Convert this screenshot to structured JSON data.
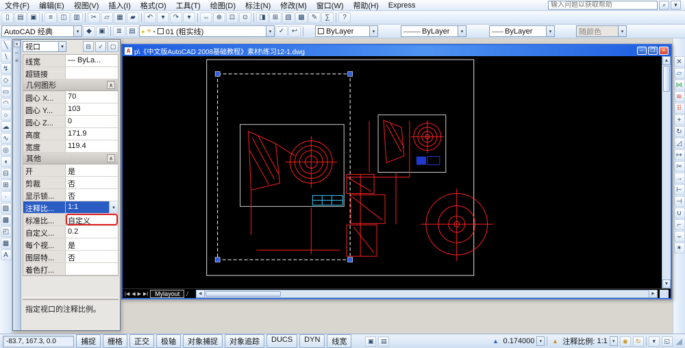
{
  "colors": {
    "cad_red": "#ff2020",
    "cad_cyan": "#39c7ff",
    "cad_blue_fill": "#2238c8",
    "grip_blue": "#2e5ce0",
    "selection_highlight": "#2a5cc4",
    "annotation_marker_red": "#e02121",
    "titlebar_blue": "#1c5be0",
    "canvas_black": "#000000"
  },
  "menu": {
    "items": [
      "文件(F)",
      "编辑(E)",
      "视图(V)",
      "插入(I)",
      "格式(O)",
      "工具(T)",
      "绘图(D)",
      "标注(N)",
      "修改(M)",
      "窗口(W)",
      "帮助(H)",
      "Express"
    ],
    "help_placeholder": "输入问题以获取帮助"
  },
  "toolbar_standard": {
    "icons": [
      {
        "name": "new-icon",
        "glyph": "▯"
      },
      {
        "name": "open-icon",
        "glyph": "▤"
      },
      {
        "name": "save-icon",
        "glyph": "▣"
      },
      {
        "sep": true
      },
      {
        "name": "plot-icon",
        "glyph": "≡"
      },
      {
        "name": "plot-preview-icon",
        "glyph": "◫"
      },
      {
        "name": "publish-icon",
        "glyph": "▥"
      },
      {
        "sep": true
      },
      {
        "name": "cut-icon",
        "glyph": "✂"
      },
      {
        "name": "copy-icon",
        "glyph": "▱"
      },
      {
        "name": "paste-icon",
        "glyph": "▦"
      },
      {
        "name": "match-properties-icon",
        "glyph": "▰"
      },
      {
        "sep": true
      },
      {
        "name": "undo-icon",
        "glyph": "↶"
      },
      {
        "name": "undo-list-icon",
        "glyph": "▾"
      },
      {
        "name": "redo-icon",
        "glyph": "↷"
      },
      {
        "name": "redo-list-icon",
        "glyph": "▾"
      },
      {
        "sep": true
      },
      {
        "name": "pan-icon",
        "glyph": "⇔"
      },
      {
        "name": "zoom-realtime-icon",
        "glyph": "⊕"
      },
      {
        "name": "zoom-window-icon",
        "glyph": "⊡"
      },
      {
        "name": "zoom-previous-icon",
        "glyph": "⊙"
      },
      {
        "sep": true
      },
      {
        "name": "properties-icon",
        "glyph": "◨"
      },
      {
        "name": "designcenter-icon",
        "glyph": "⊞"
      },
      {
        "name": "tool-palettes-icon",
        "glyph": "▧"
      },
      {
        "name": "sheet-set-manager-icon",
        "glyph": "▩"
      },
      {
        "name": "markup-set-manager-icon",
        "glyph": "✎"
      },
      {
        "name": "quickcalc-icon",
        "glyph": "∑"
      },
      {
        "sep": true
      },
      {
        "name": "help-icon",
        "glyph": "?"
      }
    ]
  },
  "toolbar_object": {
    "workspace": "AutoCAD 经典",
    "layer": "01 (粗实线)",
    "color": "ByLayer",
    "linetype": "ByLayer",
    "lineweight": "ByLayer",
    "plot_style": "随颜色"
  },
  "draw_toolbar": {
    "icons": [
      {
        "name": "line-icon",
        "glyph": "╲"
      },
      {
        "name": "construction-line-icon",
        "glyph": "∖"
      },
      {
        "name": "polyline-icon",
        "glyph": "↯"
      },
      {
        "name": "polygon-icon",
        "glyph": "◇"
      },
      {
        "name": "rectangle-icon",
        "glyph": "▭"
      },
      {
        "name": "arc-icon",
        "glyph": "◠"
      },
      {
        "name": "circle-icon",
        "glyph": "○"
      },
      {
        "name": "revision-cloud-icon",
        "glyph": "☁"
      },
      {
        "name": "spline-icon",
        "glyph": "∿"
      },
      {
        "name": "ellipse-icon",
        "glyph": "◎"
      },
      {
        "name": "ellipse-arc-icon",
        "glyph": "◖"
      },
      {
        "name": "insert-block-icon",
        "glyph": "⊟"
      },
      {
        "name": "make-block-icon",
        "glyph": "⊞"
      },
      {
        "name": "point-icon",
        "glyph": "·"
      },
      {
        "name": "hatch-icon",
        "glyph": "▨"
      },
      {
        "name": "gradient-icon",
        "glyph": "▩"
      },
      {
        "name": "region-icon",
        "glyph": "◰"
      },
      {
        "name": "table-icon",
        "glyph": "▦"
      },
      {
        "name": "mtext-icon",
        "glyph": "A"
      }
    ]
  },
  "modify_toolbar": {
    "icons": [
      {
        "name": "erase-icon",
        "glyph": "✕",
        "color": "#334a66"
      },
      {
        "name": "copy-object-icon",
        "glyph": "▱",
        "color": "#2e6fd0"
      },
      {
        "name": "mirror-icon",
        "glyph": "⋈",
        "color": "#2fa84f"
      },
      {
        "name": "offset-icon",
        "glyph": "≋",
        "color": "#d23b2f"
      },
      {
        "name": "array-icon",
        "glyph": "⠿",
        "color": "#d23b2f"
      },
      {
        "name": "move-icon",
        "glyph": "+"
      },
      {
        "name": "rotate-icon",
        "glyph": "↻"
      },
      {
        "name": "scale-icon",
        "glyph": "◿"
      },
      {
        "name": "stretch-icon",
        "glyph": "↦"
      },
      {
        "name": "trim-icon",
        "glyph": "✂"
      },
      {
        "name": "extend-icon",
        "glyph": "→"
      },
      {
        "name": "break-at-point-icon",
        "glyph": "⊢"
      },
      {
        "name": "break-icon",
        "glyph": "⊣"
      },
      {
        "name": "join-icon",
        "glyph": "∪"
      },
      {
        "name": "chamfer-icon",
        "glyph": "⌐"
      },
      {
        "name": "fillet-icon",
        "glyph": "⌣"
      },
      {
        "name": "explode-icon",
        "glyph": "✶"
      }
    ]
  },
  "palette": {
    "selector_value": "视口",
    "groups": [
      {
        "header": "",
        "id": "top",
        "rows": [
          {
            "key": "lineweight",
            "label": "线宽",
            "value": "— ByLa..."
          },
          {
            "key": "hyperlink",
            "label": "超链接",
            "value": ""
          }
        ]
      },
      {
        "header": "几何图形",
        "id": "geometry",
        "rows": [
          {
            "key": "center-x",
            "label": "圆心 X...",
            "value": "70"
          },
          {
            "key": "center-y",
            "label": "圆心 Y...",
            "value": "103"
          },
          {
            "key": "center-z",
            "label": "圆心 Z...",
            "value": "0"
          },
          {
            "key": "height",
            "label": "高度",
            "value": "171.9"
          },
          {
            "key": "width",
            "label": "宽度",
            "value": "119.4"
          }
        ]
      },
      {
        "header": "其他",
        "id": "misc",
        "rows": [
          {
            "key": "on",
            "label": "开",
            "value": "是"
          },
          {
            "key": "clipped",
            "label": "剪裁",
            "value": "否"
          },
          {
            "key": "display-locked",
            "label": "显示锁...",
            "value": "否"
          },
          {
            "key": "annotation-scale",
            "label": "注释比...",
            "value": "1:1",
            "state": "selected"
          },
          {
            "key": "standard-scale",
            "label": "标准比...",
            "value": "自定义",
            "state": "marked"
          },
          {
            "key": "custom-scale",
            "label": "自定义...",
            "value": "0.2"
          },
          {
            "key": "ucs-per-viewport",
            "label": "每个视...",
            "value": "是"
          },
          {
            "key": "layer-overrides",
            "label": "图层特...",
            "value": "否"
          },
          {
            "key": "shade-plot",
            "label": "着色打...",
            "value": ""
          }
        ]
      }
    ],
    "description": "指定视口的注释比例。"
  },
  "window": {
    "title": "p\\《中文版AutoCAD 2008基础教程》素材\\练习12-1.dwg",
    "layout_tab": "Mylayout",
    "layout_tab_suffix": "/"
  },
  "statusbar": {
    "coords": "-83.7, 167.3, 0.0",
    "toggles": [
      "捕捉",
      "栅格",
      "正交",
      "极轴",
      "对象捕捉",
      "对象追踪",
      "DUCS",
      "DYN",
      "线宽"
    ],
    "vp_scale": "0.174000",
    "anno_label": "注释比例:",
    "anno_value": "1:1"
  },
  "icon_glyphs": {
    "chevron-down-icon": "▾",
    "chevron-up-icon": "∧",
    "close-icon": "×",
    "minimize-icon": "–",
    "restore-icon": "❐",
    "search-icon": "⌕",
    "palette-autohide-icon": "⇔",
    "palette-menu-icon": "≡",
    "toggle-value-icon": "⊟",
    "quick-select-icon": "✓",
    "select-objects-icon": "▢",
    "layer-on-icon": "●",
    "layer-freeze-icon": "☀",
    "layer-lock-icon": "▪",
    "layer-manager-icon": "≣",
    "layer-states-icon": "▤",
    "make-layer-current-icon": "✓",
    "layer-previous-icon": "↩",
    "workspace-settings-icon": "◆",
    "workspace-save-icon": "▣",
    "layout-first-icon": "|◀",
    "layout-prev-icon": "◀",
    "layout-next-icon": "▶",
    "layout-last-icon": "▶|",
    "scroll-up-icon": "▲",
    "scroll-down-icon": "▼",
    "scroll-left-icon": "◀",
    "scroll-right-icon": "▶",
    "model-space-icon": "▣",
    "paper-space-icon": "▤",
    "viewport-scale-icon": "▲",
    "annotation-scale-icon": "▲",
    "annotation-visibility-icon": "◉",
    "auto-scale-icon": "↻",
    "status-menu-icon": "▾",
    "clean-screen-icon": "◱",
    "resize-grip-icon": "◢",
    "dwg-icon": "A"
  }
}
